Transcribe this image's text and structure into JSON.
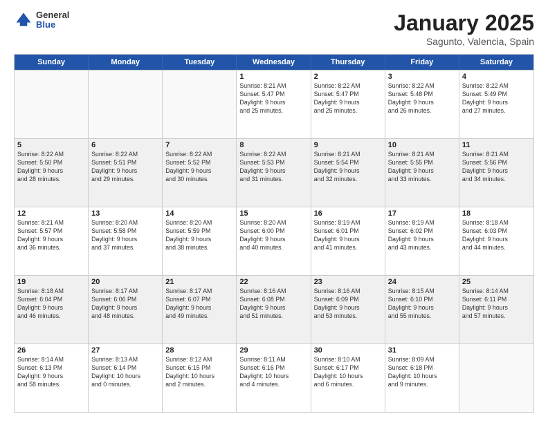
{
  "header": {
    "logo_general": "General",
    "logo_blue": "Blue",
    "title": "January 2025",
    "subtitle": "Sagunto, Valencia, Spain"
  },
  "weekdays": [
    "Sunday",
    "Monday",
    "Tuesday",
    "Wednesday",
    "Thursday",
    "Friday",
    "Saturday"
  ],
  "weeks": [
    [
      {
        "day": "",
        "text": "",
        "empty": true
      },
      {
        "day": "",
        "text": "",
        "empty": true
      },
      {
        "day": "",
        "text": "",
        "empty": true
      },
      {
        "day": "1",
        "text": "Sunrise: 8:21 AM\nSunset: 5:47 PM\nDaylight: 9 hours\nand 25 minutes."
      },
      {
        "day": "2",
        "text": "Sunrise: 8:22 AM\nSunset: 5:47 PM\nDaylight: 9 hours\nand 25 minutes."
      },
      {
        "day": "3",
        "text": "Sunrise: 8:22 AM\nSunset: 5:48 PM\nDaylight: 9 hours\nand 26 minutes."
      },
      {
        "day": "4",
        "text": "Sunrise: 8:22 AM\nSunset: 5:49 PM\nDaylight: 9 hours\nand 27 minutes."
      }
    ],
    [
      {
        "day": "5",
        "text": "Sunrise: 8:22 AM\nSunset: 5:50 PM\nDaylight: 9 hours\nand 28 minutes."
      },
      {
        "day": "6",
        "text": "Sunrise: 8:22 AM\nSunset: 5:51 PM\nDaylight: 9 hours\nand 29 minutes."
      },
      {
        "day": "7",
        "text": "Sunrise: 8:22 AM\nSunset: 5:52 PM\nDaylight: 9 hours\nand 30 minutes."
      },
      {
        "day": "8",
        "text": "Sunrise: 8:22 AM\nSunset: 5:53 PM\nDaylight: 9 hours\nand 31 minutes."
      },
      {
        "day": "9",
        "text": "Sunrise: 8:21 AM\nSunset: 5:54 PM\nDaylight: 9 hours\nand 32 minutes."
      },
      {
        "day": "10",
        "text": "Sunrise: 8:21 AM\nSunset: 5:55 PM\nDaylight: 9 hours\nand 33 minutes."
      },
      {
        "day": "11",
        "text": "Sunrise: 8:21 AM\nSunset: 5:56 PM\nDaylight: 9 hours\nand 34 minutes."
      }
    ],
    [
      {
        "day": "12",
        "text": "Sunrise: 8:21 AM\nSunset: 5:57 PM\nDaylight: 9 hours\nand 36 minutes."
      },
      {
        "day": "13",
        "text": "Sunrise: 8:20 AM\nSunset: 5:58 PM\nDaylight: 9 hours\nand 37 minutes."
      },
      {
        "day": "14",
        "text": "Sunrise: 8:20 AM\nSunset: 5:59 PM\nDaylight: 9 hours\nand 38 minutes."
      },
      {
        "day": "15",
        "text": "Sunrise: 8:20 AM\nSunset: 6:00 PM\nDaylight: 9 hours\nand 40 minutes."
      },
      {
        "day": "16",
        "text": "Sunrise: 8:19 AM\nSunset: 6:01 PM\nDaylight: 9 hours\nand 41 minutes."
      },
      {
        "day": "17",
        "text": "Sunrise: 8:19 AM\nSunset: 6:02 PM\nDaylight: 9 hours\nand 43 minutes."
      },
      {
        "day": "18",
        "text": "Sunrise: 8:18 AM\nSunset: 6:03 PM\nDaylight: 9 hours\nand 44 minutes."
      }
    ],
    [
      {
        "day": "19",
        "text": "Sunrise: 8:18 AM\nSunset: 6:04 PM\nDaylight: 9 hours\nand 46 minutes."
      },
      {
        "day": "20",
        "text": "Sunrise: 8:17 AM\nSunset: 6:06 PM\nDaylight: 9 hours\nand 48 minutes."
      },
      {
        "day": "21",
        "text": "Sunrise: 8:17 AM\nSunset: 6:07 PM\nDaylight: 9 hours\nand 49 minutes."
      },
      {
        "day": "22",
        "text": "Sunrise: 8:16 AM\nSunset: 6:08 PM\nDaylight: 9 hours\nand 51 minutes."
      },
      {
        "day": "23",
        "text": "Sunrise: 8:16 AM\nSunset: 6:09 PM\nDaylight: 9 hours\nand 53 minutes."
      },
      {
        "day": "24",
        "text": "Sunrise: 8:15 AM\nSunset: 6:10 PM\nDaylight: 9 hours\nand 55 minutes."
      },
      {
        "day": "25",
        "text": "Sunrise: 8:14 AM\nSunset: 6:11 PM\nDaylight: 9 hours\nand 57 minutes."
      }
    ],
    [
      {
        "day": "26",
        "text": "Sunrise: 8:14 AM\nSunset: 6:13 PM\nDaylight: 9 hours\nand 58 minutes."
      },
      {
        "day": "27",
        "text": "Sunrise: 8:13 AM\nSunset: 6:14 PM\nDaylight: 10 hours\nand 0 minutes."
      },
      {
        "day": "28",
        "text": "Sunrise: 8:12 AM\nSunset: 6:15 PM\nDaylight: 10 hours\nand 2 minutes."
      },
      {
        "day": "29",
        "text": "Sunrise: 8:11 AM\nSunset: 6:16 PM\nDaylight: 10 hours\nand 4 minutes."
      },
      {
        "day": "30",
        "text": "Sunrise: 8:10 AM\nSunset: 6:17 PM\nDaylight: 10 hours\nand 6 minutes."
      },
      {
        "day": "31",
        "text": "Sunrise: 8:09 AM\nSunset: 6:18 PM\nDaylight: 10 hours\nand 9 minutes."
      },
      {
        "day": "",
        "text": "",
        "empty": true
      }
    ]
  ]
}
